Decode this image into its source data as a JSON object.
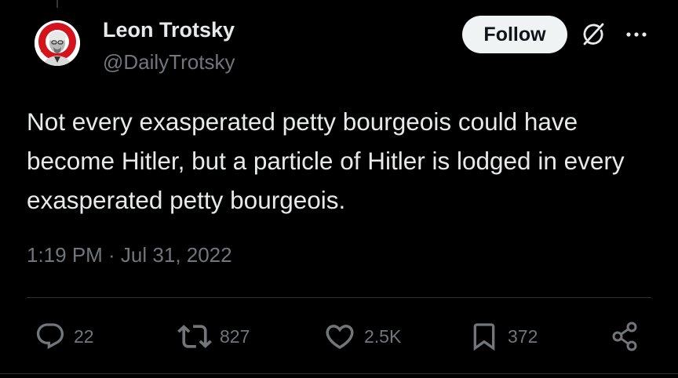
{
  "author": {
    "name": "Leon Trotsky",
    "handle": "@DailyTrotsky"
  },
  "follow_label": "Follow",
  "tweet_text": "Not every exasperated petty bourgeois could have become Hitler, but a particle of Hitler is lodged in every exasperated petty bourgeois.",
  "timestamp": "1:19 PM · Jul 31, 2022",
  "actions": {
    "replies": "22",
    "reposts": "827",
    "likes": "2.5K",
    "bookmarks": "372"
  },
  "icons": [
    "grok-icon",
    "more-icon",
    "reply-icon",
    "repost-icon",
    "like-icon",
    "bookmark-icon",
    "share-icon"
  ],
  "colors": {
    "background": "#000000",
    "text": "#e7e9ea",
    "secondary_text": "#71767b",
    "follow_button": "#eff3f4",
    "avatar_accent": "#d4141c"
  }
}
